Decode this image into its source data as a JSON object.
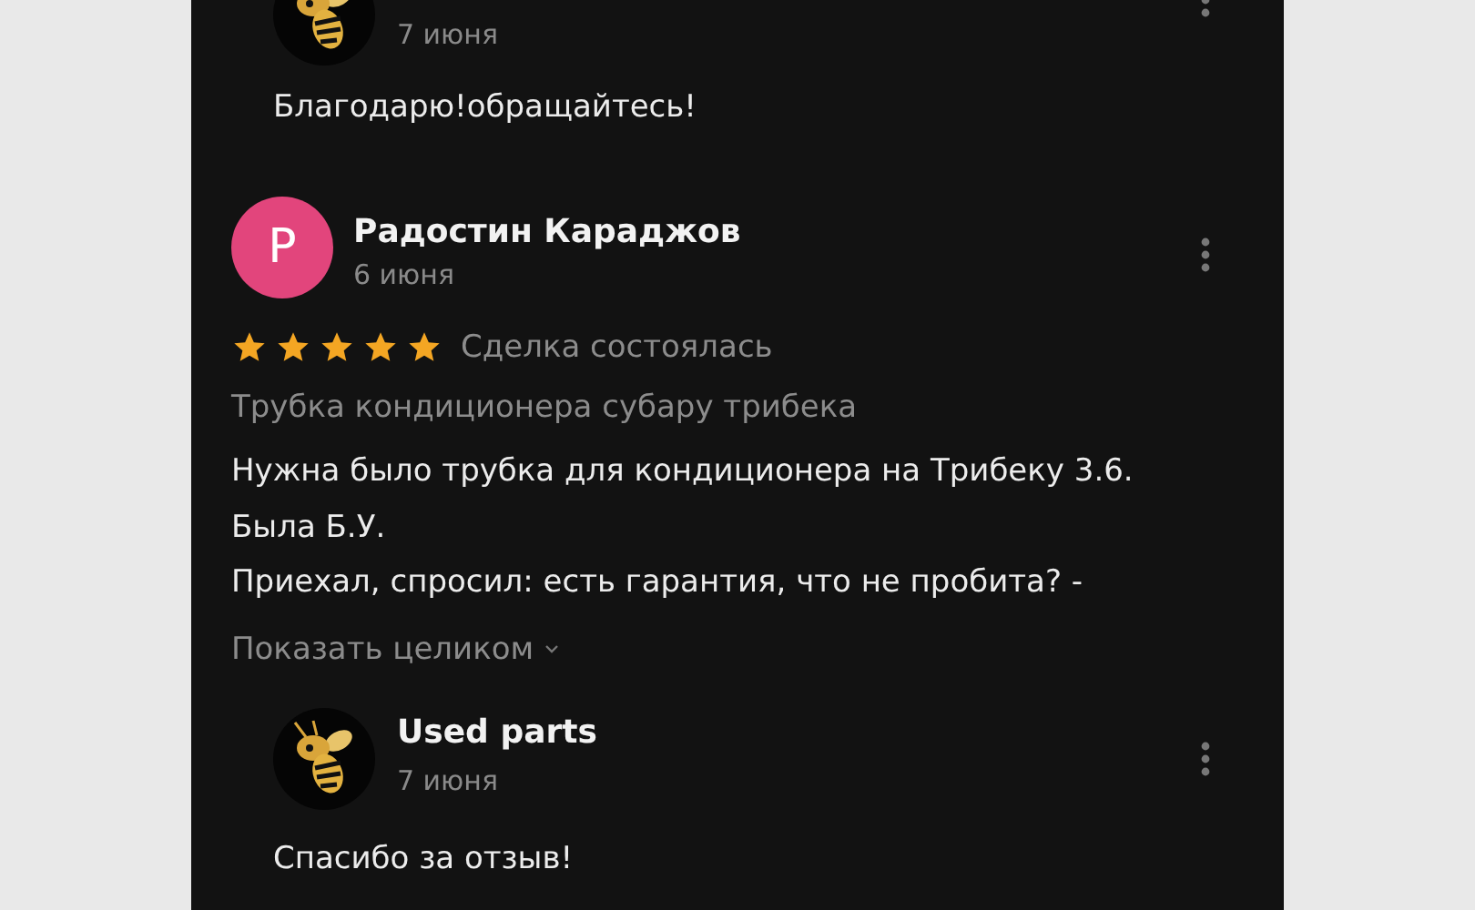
{
  "top_reply": {
    "date": "7 июня",
    "text": "Благодарю!обращайтесь!"
  },
  "review": {
    "avatar_letter": "Р",
    "author": "Радостин Караджов",
    "date": "6 июня",
    "stars": 5,
    "status": "Сделка состоялась",
    "item": "Трубка кондиционера субару трибека",
    "text_lines": [
      "Нужна было трубка для кондиционера на Трибеку 3.6.",
      "Была Б.У.",
      "Приехал, спросил: есть гарантия, что не пробита? -"
    ],
    "expand_link": "Показать целиком",
    "reply": {
      "author": "Used parts",
      "date": "7 июня",
      "text": "Спасибо за отзыв!"
    }
  }
}
